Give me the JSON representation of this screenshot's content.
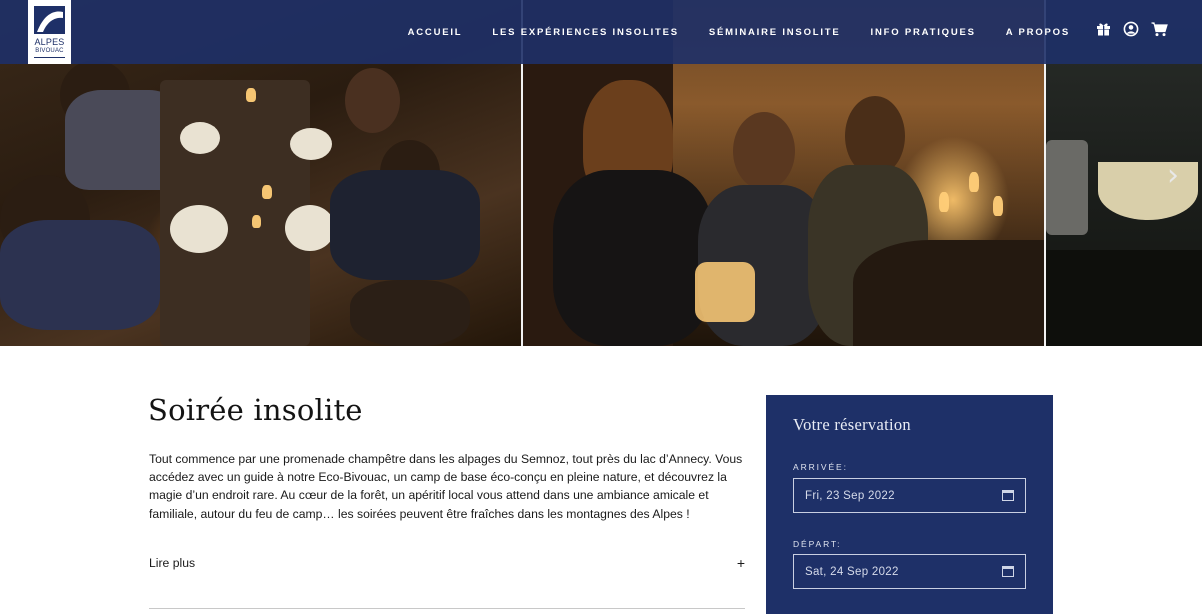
{
  "header": {
    "logo": {
      "line1": "ALPES",
      "line2": "BIVOUAC"
    },
    "nav": [
      "ACCUEIL",
      "LES EXPÉRIENCES INSOLITES",
      "SÉMINAIRE INSOLITE",
      "INFO PRATIQUES",
      "A PROPOS"
    ],
    "icons": [
      "gift-icon",
      "account-icon",
      "cart-icon"
    ]
  },
  "gallery": {
    "photos": [
      "photo-dinner-table",
      "photo-friends-candles",
      "photo-kitchen-pot"
    ],
    "next_arrow": "›"
  },
  "main": {
    "title": "Soirée insolite",
    "intro": "Tout commence par une promenade champêtre dans les alpages du Semnoz, tout près du lac d’Annecy. Vous accédez avec un guide à notre Eco-Bivouac, un camp de base éco-conçu en pleine nature, et découvrez la magie d’un endroit rare. Au cœur de la forêt, un apéritif local vous attend dans une ambiance amicale et familiale, autour du feu de camp… les soirées peuvent être fraîches dans les montagnes des Alpes !",
    "read_more": "Lire plus",
    "read_more_icon": "+"
  },
  "booking": {
    "title": "Votre réservation",
    "arrival_label": "ARRIVÉE:",
    "arrival_value": "Fri, 23 Sep 2022",
    "departure_label": "DÉPART:",
    "departure_value": "Sat, 24 Sep 2022"
  },
  "colors": {
    "brand": "#1e3068",
    "header_bg": "rgba(30,48,104,0.9)"
  }
}
